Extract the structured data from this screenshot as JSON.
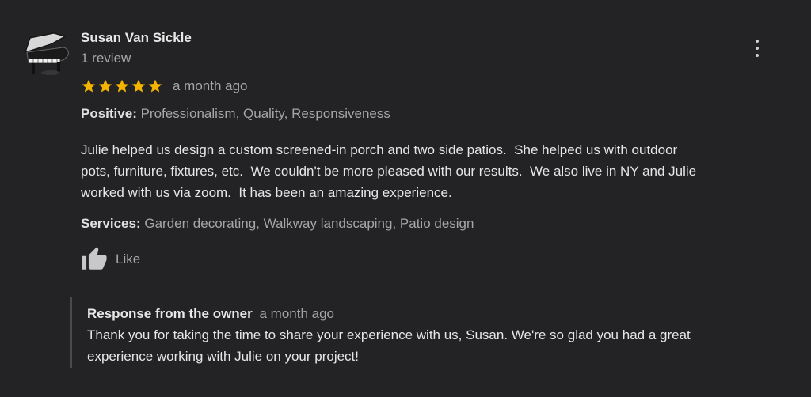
{
  "reviewer": {
    "name": "Susan Van Sickle",
    "review_count": "1 review",
    "avatar_icon": "grand-piano-icon"
  },
  "rating": {
    "stars": 5,
    "max_stars": 5,
    "star_color": "#f4b400",
    "time_ago": "a month ago"
  },
  "positive": {
    "label": "Positive:",
    "value": "Professionalism, Quality, Responsiveness"
  },
  "review_text": [
    "Julie helped us design a custom screened-in porch and two side patios.  She helped us with outdoor",
    "pots, furniture, fixtures, etc.  We couldn't be more pleased with our results.  We also live in NY and Julie",
    "worked with us via zoom.  It has been an amazing experience."
  ],
  "services": {
    "label": "Services:",
    "value": "Garden decorating, Walkway landscaping, Patio design"
  },
  "like": {
    "label": "Like",
    "icon": "thumbs-up-icon"
  },
  "more_menu": {
    "icon": "more-vert-icon"
  },
  "owner_response": {
    "title": "Response from the owner",
    "time_ago": "a month ago",
    "lines": [
      "Thank you for taking the time to share your experience with us, Susan. We're so glad you had a great",
      "experience working with Julie on your project!"
    ]
  },
  "colors": {
    "background": "#232325",
    "primary_text": "#e6e6e8",
    "secondary_text": "#a6a6a8",
    "star": "#f4b400"
  }
}
